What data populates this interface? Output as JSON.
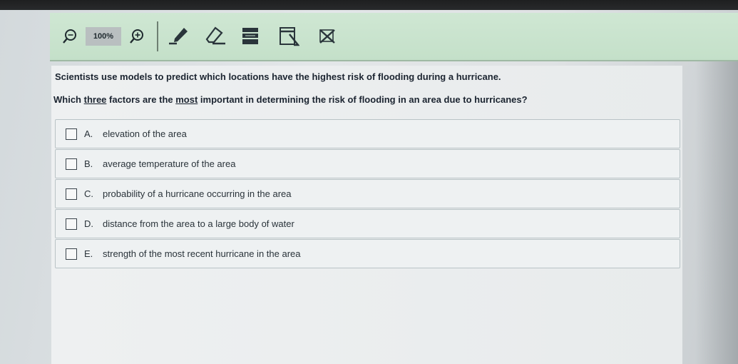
{
  "toolbar": {
    "zoom_out_icon": "zoom-out-icon",
    "zoom_level": "100%",
    "zoom_in_icon": "zoom-in-icon",
    "tools": [
      "pen-icon",
      "eraser-icon",
      "line-reader-icon",
      "notepad-icon",
      "answer-eliminator-icon"
    ]
  },
  "question": {
    "stem": "Scientists use models to predict which locations have the highest risk of flooding during a hurricane.",
    "prompt_part1": "Which ",
    "prompt_three": "three",
    "prompt_part2": " factors are the ",
    "prompt_most": "most",
    "prompt_part3": " important in determining the risk of flooding in an area due to hurricanes?",
    "options": [
      {
        "letter": "A.",
        "text": "elevation of the area",
        "checked": false
      },
      {
        "letter": "B.",
        "text": "average temperature of the area",
        "checked": false
      },
      {
        "letter": "C.",
        "text": "probability of a hurricane occurring in the area",
        "checked": false
      },
      {
        "letter": "D.",
        "text": "distance from the area to a large body of water",
        "checked": false
      },
      {
        "letter": "E.",
        "text": "strength of the most recent hurricane in the area",
        "checked": false
      }
    ]
  },
  "colors": {
    "toolbar_bg": "#c4e0c9",
    "content_bg": "#eef0f1",
    "text": "#1b2430"
  }
}
